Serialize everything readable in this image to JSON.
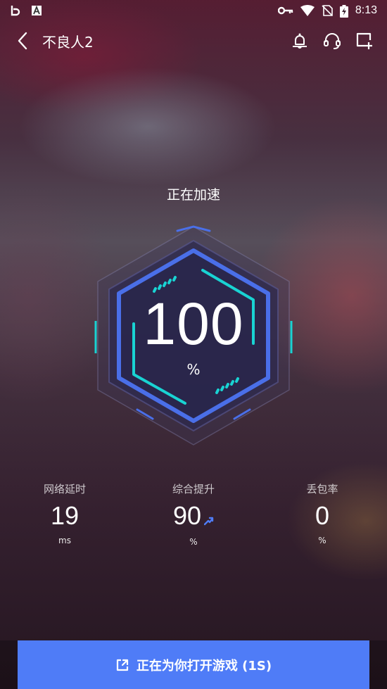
{
  "status_bar": {
    "time": "8:13",
    "left_icons": [
      "bilibili-icon",
      "font-a-icon"
    ],
    "right_icons": [
      "key-icon",
      "wifi-icon",
      "no-sim-icon",
      "battery-icon"
    ]
  },
  "header": {
    "title": "不良人2",
    "actions": [
      "bell-icon",
      "headset-icon",
      "add-window-icon"
    ]
  },
  "accelerator": {
    "status": "正在加速",
    "progress_value": "100",
    "progress_unit": "%"
  },
  "stats": [
    {
      "label": "网络延时",
      "value": "19",
      "unit": "ms"
    },
    {
      "label": "综合提升",
      "value": "90",
      "unit": "%",
      "trend": "up"
    },
    {
      "label": "丢包率",
      "value": "0",
      "unit": "%"
    }
  ],
  "footer": {
    "button_label": "正在为你打开游戏 (1S)",
    "button_icon": "open-external-icon"
  },
  "colors": {
    "accent_blue": "#4f7cf7",
    "cyan": "#19d3d3",
    "gauge_blue": "#4a6fe8"
  }
}
